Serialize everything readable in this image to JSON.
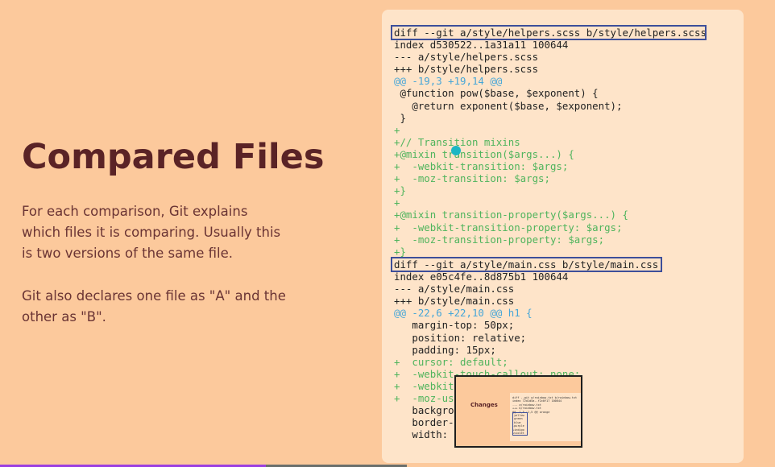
{
  "slide": {
    "title": "Compared Files",
    "paragraph1": "For each comparison, Git explains which files it is comparing. Usually this is two versions of the same file.",
    "paragraph2": "Git also declares one file as \"A\" and the other as \"B\"."
  },
  "diff1": [
    {
      "t": "diff --git a/style/helpers.scss b/style/helpers.scss",
      "c": ""
    },
    {
      "t": "index d530522..1a31a11 100644",
      "c": ""
    },
    {
      "t": "--- a/style/helpers.scss",
      "c": ""
    },
    {
      "t": "+++ b/style/helpers.scss",
      "c": ""
    },
    {
      "t": "@@ -19,3 +19,14 @@",
      "c": "b"
    },
    {
      "t": " @function pow($base, $exponent) {",
      "c": ""
    },
    {
      "t": "   @return exponent($base, $exponent);",
      "c": ""
    },
    {
      "t": " }",
      "c": ""
    },
    {
      "t": "+",
      "c": "g"
    },
    {
      "t": "+// Transition mixins",
      "c": "g"
    },
    {
      "t": "+@mixin transition($args...) {",
      "c": "g"
    },
    {
      "t": "+  -webkit-transition: $args;",
      "c": "g"
    },
    {
      "t": "+  -moz-transition: $args;",
      "c": "g"
    },
    {
      "t": "+}",
      "c": "g"
    },
    {
      "t": "+",
      "c": "g"
    },
    {
      "t": "+@mixin transition-property($args...) {",
      "c": "g"
    },
    {
      "t": "+  -webkit-transition-property: $args;",
      "c": "g"
    },
    {
      "t": "+  -moz-transition-property: $args;",
      "c": "g"
    },
    {
      "t": "+}",
      "c": "g"
    }
  ],
  "diff2": [
    {
      "t": "diff --git a/style/main.css b/style/main.css",
      "c": ""
    },
    {
      "t": "index e05c4fe..8d875b1 100644",
      "c": ""
    },
    {
      "t": "--- a/style/main.css",
      "c": ""
    },
    {
      "t": "+++ b/style/main.css",
      "c": ""
    },
    {
      "t": "@@ -22,6 +22,10 @@ h1 {",
      "c": "b"
    },
    {
      "t": "   margin-top: 50px;",
      "c": ""
    },
    {
      "t": "   position: relative;",
      "c": ""
    },
    {
      "t": "   padding: 15px;",
      "c": ""
    },
    {
      "t": "+  cursor: default;",
      "c": "g"
    },
    {
      "t": "+  -webkit-touch-callout: none;",
      "c": "g"
    },
    {
      "t": "+  -webkit",
      "c": "g"
    },
    {
      "t": "+  -moz-us",
      "c": "g"
    },
    {
      "t": "   backgro",
      "c": ""
    },
    {
      "t": "   border-",
      "c": ""
    },
    {
      "t": "   width:",
      "c": ""
    }
  ],
  "thumbnail": {
    "title": "Changes",
    "code": "diff --git a/rainbow.txt b/rainbow.txt\nindex 72d1d5a..f2c0f17 100644\n--- a/rainbow.txt\n+++ b/rainbow.txt\n@@ -1,5 +1,5 @@ orange\n yellow\n green\n blue\n-purple\n+indigo\n+violet"
  },
  "colors": {
    "background": "#fcc99c",
    "panel": "#fee4c9",
    "title": "#5a2326",
    "added": "#4fb45c",
    "hunk": "#46a6d8",
    "highlight": "#3d4f9a"
  }
}
